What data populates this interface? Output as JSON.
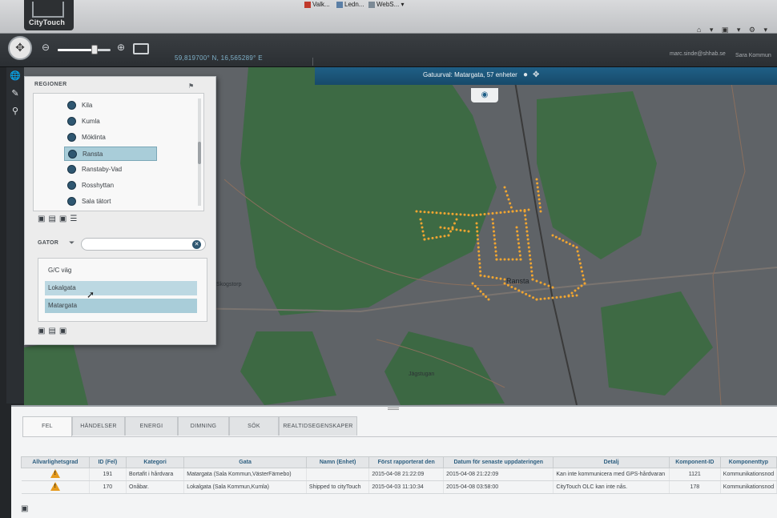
{
  "browser": {
    "logo_text": "CityTouch",
    "bookmarks": [
      "Valk...",
      "Ledn...",
      "WebS..."
    ],
    "toolbar_glyphs": "⌂ ▾ ▣ ▾ ⚙ ▾"
  },
  "toolbar": {
    "coords": "59,819700° N, 16,565289° E",
    "zoom_level": 0.7,
    "user": "marc.sinde@shhab.se",
    "signout": "Sara Kommun"
  },
  "selection": {
    "label": "Gatuurval:   Matargata, 57 enheter"
  },
  "left_tools": [
    "🌐",
    "✎",
    "⚲"
  ],
  "regions": {
    "title": "REGIONER",
    "items": [
      {
        "label": "Kila",
        "selected": false
      },
      {
        "label": "Kumla",
        "selected": false
      },
      {
        "label": "Möklinta",
        "selected": false
      },
      {
        "label": "Ransta",
        "selected": true
      },
      {
        "label": "Ranstaby-Vad",
        "selected": false
      },
      {
        "label": "Rosshyttan",
        "selected": false
      },
      {
        "label": "Sala tätort",
        "selected": false
      }
    ],
    "icon_row": "▣▤▣☰",
    "streets_title": "GATOR",
    "search_value": "",
    "streets": [
      {
        "label": "G/C väg",
        "state": "normal"
      },
      {
        "label": "Lokalgata",
        "state": "hover"
      },
      {
        "label": "Matargata",
        "state": "selected"
      }
    ],
    "bottom_icons": "▣▤▣"
  },
  "map": {
    "labels": {
      "town": "Ransta",
      "place": "Skogstorp",
      "road": "Jägstugan"
    }
  },
  "bottom": {
    "tabs": [
      "FEL",
      "HÄNDELSER",
      "ENERGI",
      "DIMNING",
      "SÖK",
      "REALTIDSEGENSKAPER"
    ],
    "active_tab": 0,
    "columns": [
      "Allvarlighetsgrad",
      "ID (Fel)",
      "Kategori",
      "Gata",
      "Namn (Enhet)",
      "Först rapporterat den",
      "Datum för senaste uppdateringen",
      "Detalj",
      "Komponent-ID",
      "Komponenttyp"
    ],
    "rows": [
      {
        "severity": "warning",
        "id": "191",
        "category": "Bortafit i hårdvara",
        "street": "Matargata (Sala Kommun,VästerFärnebo)",
        "unit": "",
        "first": "2015-04-08 21:22:09",
        "updated": "2015-04-08 21:22:09",
        "detail": "Kan inte kommunicera med GPS-hårdvaran",
        "component_id": "1121",
        "component_type": "Kommunikationsnod"
      },
      {
        "severity": "warning",
        "id": "170",
        "category": "Onåbar.",
        "street": "Lokalgata (Sala Kommun,Kumla)",
        "unit": "Shipped to cityTouch",
        "first": "2015-04-03 11:10:34",
        "updated": "2015-04-08 03:58:00",
        "detail": "CityTouch OLC kan inte nås.",
        "component_id": "178",
        "component_type": "Kommunikationsnod"
      }
    ]
  },
  "colors": {
    "accent": "#1f5f86",
    "forest": "#3f6b45",
    "dots": "#f0a531",
    "warning": "#e59a1c"
  }
}
